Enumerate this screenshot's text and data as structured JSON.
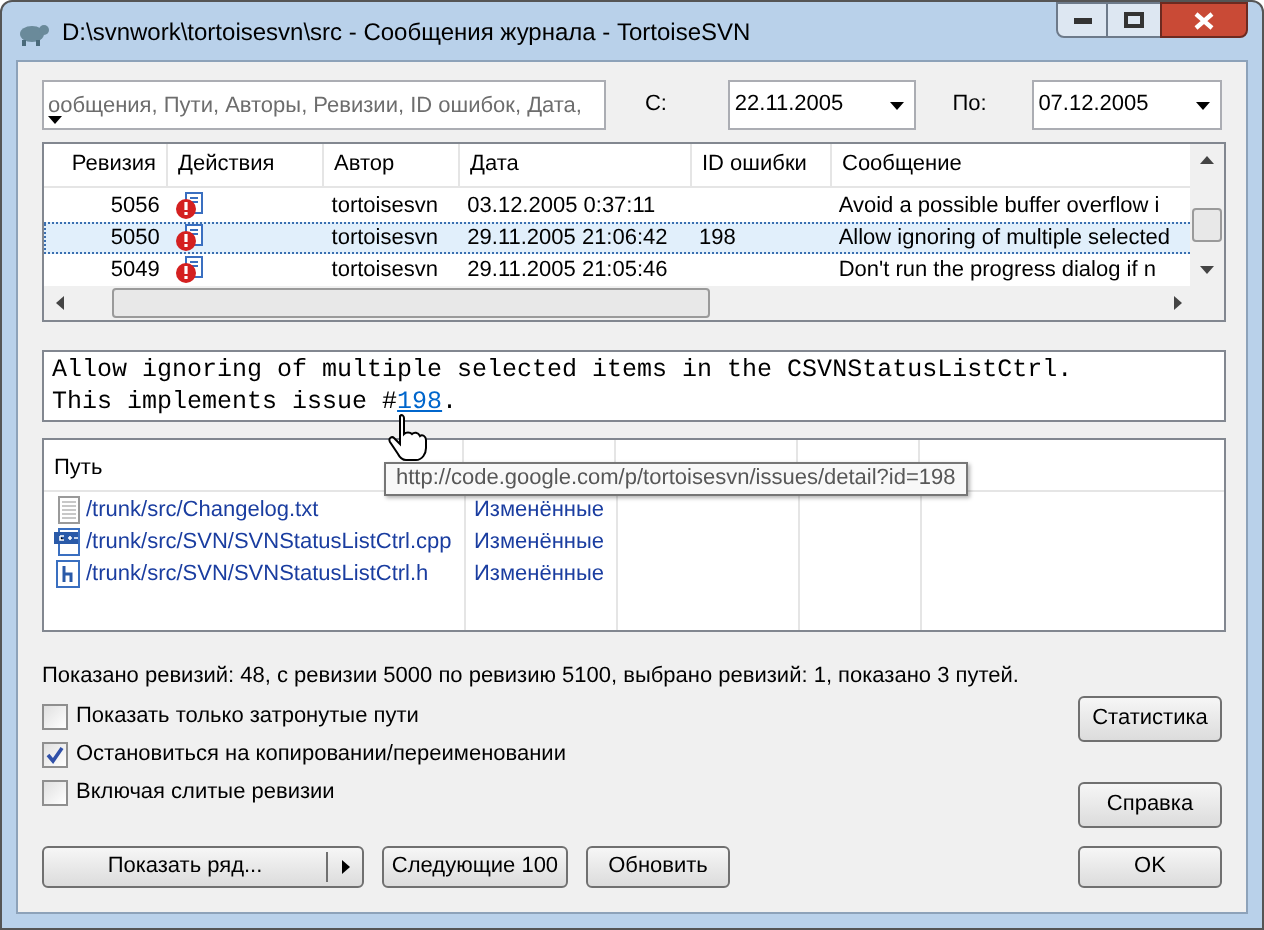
{
  "window": {
    "title": "D:\\svnwork\\tortoisesvn\\src - Сообщения журнала - TortoiseSVN"
  },
  "filter": {
    "placeholder": "ообщения, Пути, Авторы, Ревизии, ID ошибок, Дата,"
  },
  "from": {
    "label": "С:",
    "value": "22.11.2005"
  },
  "to": {
    "label": "По:",
    "value": "07.12.2005"
  },
  "log": {
    "columns": [
      "Ревизия",
      "Действия",
      "Автор",
      "Дата",
      "ID ошибки",
      "Сообщение"
    ],
    "rows": [
      {
        "revision": "5056",
        "author": "tortoisesvn",
        "date": "03.12.2005 0:37:11",
        "bug_id": "",
        "message": "Avoid a possible buffer overflow i",
        "selected": false
      },
      {
        "revision": "5050",
        "author": "tortoisesvn",
        "date": "29.11.2005 21:06:42",
        "bug_id": "198",
        "message": "Allow ignoring of multiple selected",
        "selected": true
      },
      {
        "revision": "5049",
        "author": "tortoisesvn",
        "date": "29.11.2005 21:05:46",
        "bug_id": "",
        "message": "Don't run the progress dialog if n",
        "selected": false
      }
    ]
  },
  "message": {
    "line_1": "Allow ignoring of multiple selected items in the CSVNStatusListCtrl.",
    "line_2_prefix": "This implements issue #",
    "line_2_link": "198",
    "line_2_suffix": "."
  },
  "tooltip": "http://code.google.com/p/tortoisesvn/issues/detail?id=198",
  "paths": {
    "columns": [
      "Путь"
    ],
    "rows": [
      {
        "kind": "text",
        "path": "/trunk/src/Changelog.txt",
        "action": "Изменённые"
      },
      {
        "kind": "cpp",
        "path": "/trunk/src/SVN/SVNStatusListCtrl.cpp",
        "action": "Изменённые"
      },
      {
        "kind": "header",
        "path": "/trunk/src/SVN/SVNStatusListCtrl.h",
        "action": "Изменённые"
      }
    ]
  },
  "status": "Показано ревизий: 48, с ревизии 5000 по ревизию 5100, выбрано ревизий: 1, показано 3 путей.",
  "options": [
    {
      "label": "Показать только затронутые пути",
      "checked": false
    },
    {
      "label": "Остановиться на копировании/переименовании",
      "checked": true
    },
    {
      "label": "Включая слитые ревизии",
      "checked": false
    }
  ],
  "buttons": {
    "statistics": "Статистика",
    "help": "Справка",
    "show_range": "Показать ряд...",
    "next": "Следующие 100",
    "refresh": "Обновить",
    "ok": "OK"
  }
}
